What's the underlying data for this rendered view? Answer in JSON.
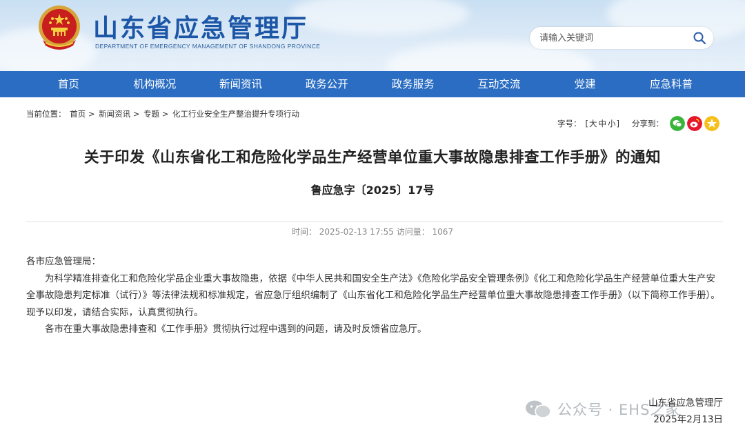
{
  "header": {
    "title": "山东省应急管理厅",
    "subtitle": "DEPARTMENT OF EMERGENCY MANAGEMENT OF SHANDONG PROVINCE",
    "emblem_icon": "national-emblem-icon",
    "search": {
      "placeholder": "请输入关键词",
      "icon": "search-icon"
    }
  },
  "nav": {
    "items": [
      {
        "label": "首页"
      },
      {
        "label": "机构概况"
      },
      {
        "label": "新闻资讯"
      },
      {
        "label": "政务公开"
      },
      {
        "label": "政务服务"
      },
      {
        "label": "互动交流"
      },
      {
        "label": "党建"
      },
      {
        "label": "应急科普"
      }
    ],
    "background": "#2a6dc2"
  },
  "breadcrumb": {
    "prefix": "当前位置：",
    "items": [
      "首页",
      "新闻资讯",
      "专题",
      "化工行业安全生产整治提升专项行动"
    ],
    "separator": ">"
  },
  "tools": {
    "font_size_label": "字号：",
    "open_bracket": "[",
    "sizes": [
      "大",
      "中",
      "小"
    ],
    "close_bracket": "]",
    "share_label": "分享到：",
    "share_icons": [
      {
        "name": "wechat-icon",
        "color": "#3bb43b"
      },
      {
        "name": "weibo-icon",
        "color": "#e6162d"
      },
      {
        "name": "qzone-icon",
        "color": "#f5c019"
      }
    ]
  },
  "article": {
    "title": "关于印发《山东省化工和危险化学品生产经营单位重大事故隐患排查工作手册》的通知",
    "doc_number": "鲁应急字〔2025〕17号",
    "meta": "时间：  2025-02-13 17:55 访问量：  1067",
    "paragraphs": [
      "各市应急管理局：",
      "为科学精准排查化工和危险化学品企业重大事故隐患，依据《中华人民共和国安全生产法》《危险化学品安全管理条例》《化工和危险化学品生产经营单位重大生产安全事故隐患判定标准（试行）》等法律法规和标准规定，省应急厅组织编制了《山东省化工和危险化学品生产经营单位重大事故隐患排查工作手册》（以下简称工作手册）。现予以印发，请结合实际，认真贯彻执行。",
      "各市在重大事故隐患排查和《工作手册》贯彻执行过程中遇到的问题，请及时反馈省应急厅。"
    ],
    "signature": "山东省应急管理厅",
    "date": "2025年2月13日"
  },
  "watermark": {
    "text": "公众号 · EHS之家"
  }
}
